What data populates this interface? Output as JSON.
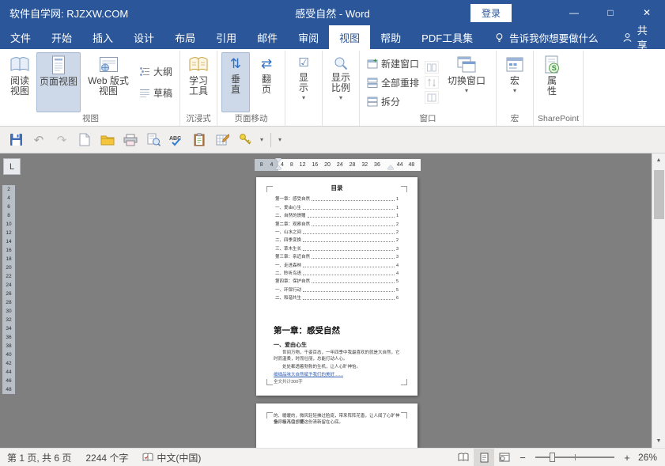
{
  "colors": {
    "accent": "#2b579a",
    "titlebar": "#2b579a",
    "canvas": "#7f7f7f",
    "selection": "#cdd8e8"
  },
  "titlebar": {
    "left": "软件自学网: RJZXW.COM",
    "center": "感受自然 - Word",
    "login": "登录",
    "minimize": "—",
    "maximize": "□",
    "close": "✕"
  },
  "tabs": [
    {
      "label": "文件"
    },
    {
      "label": "开始"
    },
    {
      "label": "插入"
    },
    {
      "label": "设计"
    },
    {
      "label": "布局"
    },
    {
      "label": "引用"
    },
    {
      "label": "邮件"
    },
    {
      "label": "审阅"
    },
    {
      "label": "视图"
    },
    {
      "label": "帮助"
    },
    {
      "label": "PDF工具集"
    }
  ],
  "tellme": "告诉我你想要做什么",
  "share": "共享",
  "ribbon": {
    "views": {
      "read": "阅读视图",
      "print": "页面视图",
      "web": "Web 版式视图",
      "outline": "大纲",
      "draft": "草稿",
      "label": "视图"
    },
    "immersive": {
      "learning": "学习工具",
      "label": "沉浸式"
    },
    "movement": {
      "vertical": "垂直",
      "flip": "翻页",
      "label": "页面移动"
    },
    "show": {
      "button": "显示"
    },
    "zoomgrp": {
      "button": "显示比例"
    },
    "window": {
      "new_window": "新建窗口",
      "arrange": "全部重排",
      "split": "拆分",
      "switch": "切换窗口",
      "label": "窗口"
    },
    "macros": {
      "button": "宏",
      "label": "宏"
    },
    "sharepoint": {
      "properties": "属性",
      "label": "SharePoint"
    }
  },
  "ruler": {
    "tab": "L",
    "h_left": "8 4",
    "h_mid": "4 8 12 16 20 24 28 32 36",
    "h_right": "44 48",
    "v": "2\n4\n6\n8\n10\n12\n14\n16\n18\n20\n22\n24\n26\n28\n30\n32\n34\n36\n38\n40\n42\n44\n46\n48"
  },
  "doc": {
    "toc_title": "目录",
    "toc": [
      {
        "t": "第一章：感受自然",
        "p": "1"
      },
      {
        "t": "一、爱由心生",
        "p": "1"
      },
      {
        "t": "二、自然的馈赠",
        "p": "1"
      },
      {
        "t": "第二章：观察自然",
        "p": "2"
      },
      {
        "t": "一、山水之间",
        "p": "2"
      },
      {
        "t": "二、四季变换",
        "p": "2"
      },
      {
        "t": "三、草木生长",
        "p": "3"
      },
      {
        "t": "第三章：亲近自然",
        "p": "3"
      },
      {
        "t": "一、走进森林",
        "p": "4"
      },
      {
        "t": "二、聆听鸟语",
        "p": "4"
      },
      {
        "t": "第四章：保护自然",
        "p": "5"
      },
      {
        "t": "一、环保行动",
        "p": "5"
      },
      {
        "t": "二、和谐共生",
        "p": "6"
      }
    ],
    "heading": "第一章：感受自然",
    "subheading": "一、爱由心生",
    "para1": "世间万物，千姿百态，一年四季中我最喜欢的就是大自然，它时而温柔，时而壮丽，总能打动人心。",
    "para2": "处处都透着勃勃的生机，让人心旷神怡。",
    "para3": "细细品味大自然赋予我们的美好……",
    "para4": "全文共计300字",
    "p2line1": "的、暖暖的，微风轻轻拂过脸庞，带来阵阵花香，让人闻了心旷神怡，忍不住想要",
    "p2line2": "多呼吸几口，把这份清新留在心底。"
  },
  "statusbar": {
    "page": "第 1 页, 共 6 页",
    "words": "2244 个字",
    "lang": "中文(中国)",
    "zoom_out": "−",
    "zoom_in": "+",
    "zoom": "26%"
  }
}
